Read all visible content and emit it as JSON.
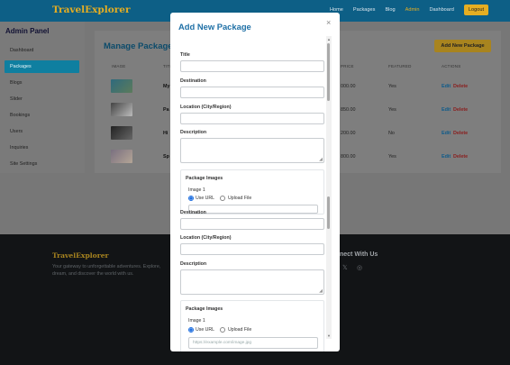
{
  "navbar": {
    "brand": "TravelExplorer",
    "links": [
      "Home",
      "Packages",
      "Blog",
      "Admin",
      "Dashboard"
    ],
    "logout": "Logout",
    "active_color": "#e6ae22"
  },
  "sidebar": {
    "title": "Admin Panel",
    "items": [
      "Dashboard",
      "Packages",
      "Blogs",
      "Slider",
      "Bookings",
      "Users",
      "Inquiries",
      "Site Settings"
    ],
    "active": "Packages"
  },
  "main": {
    "title": "Manage Packages",
    "add_button": "Add New Package",
    "columns": [
      "IMAGE",
      "TITLE",
      "PRICE",
      "FEATURED",
      "ACTIONS"
    ],
    "rows": [
      {
        "name": "My",
        "price": "000.00",
        "featured": "Yes",
        "edit": "Edit",
        "delete": "Delete"
      },
      {
        "name": "Pa",
        "price": "850.00",
        "featured": "Yes",
        "edit": "Edit",
        "delete": "Delete"
      },
      {
        "name": "Hi",
        "price": "200.00",
        "featured": "No",
        "edit": "Edit",
        "delete": "Delete"
      },
      {
        "name": "Sp",
        "price": "800.00",
        "featured": "Yes",
        "edit": "Edit",
        "delete": "Delete"
      }
    ]
  },
  "footer": {
    "brand": "TravelExplorer",
    "tagline": "Your gateway to unforgettable adventures. Explore, dream, and discover the world with us.",
    "connect_title": "nect With Us"
  },
  "modal": {
    "title": "Add New Package",
    "close": "×",
    "labels": {
      "title": "Title",
      "destination": "Destination",
      "location": "Location (City/Region)",
      "description": "Description",
      "package_images": "Package Images",
      "image1": "Image 1",
      "use_url": "Use URL",
      "upload_file": "Upload File"
    },
    "url_placeholder": "https://example.com/image.jpg",
    "accent": "#1f70a6"
  },
  "icons": {
    "close": "close-icon",
    "resize": "resize-grip-icon",
    "twitter": "twitter-icon",
    "instagram": "instagram-icon",
    "facebook": "facebook-icon"
  }
}
